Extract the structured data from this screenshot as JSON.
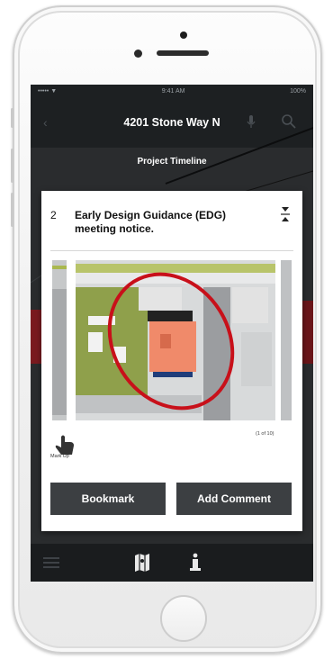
{
  "status_bar": {
    "carrier": "••••• ▼",
    "time": "9:41 AM",
    "battery": "100%"
  },
  "header": {
    "title": "4201 Stone Way N",
    "back_icon": "chevron-left-icon",
    "right_icons": [
      "mic-icon",
      "search-icon"
    ]
  },
  "subheader": {
    "title": "Project Timeline"
  },
  "card": {
    "item_number": "2",
    "item_title": "Early Design Guidance (EDG) meeting notice.",
    "collapse_icon": "collapse-icon",
    "markup_label": "Mark Up",
    "page_count": "(1 of 10)",
    "bookmark_label": "Bookmark",
    "add_comment_label": "Add Comment"
  },
  "tabbar": {
    "icons": [
      "list-icon",
      "map-icon",
      "info-icon"
    ]
  },
  "colors": {
    "screen_bg": "#1c1e20",
    "button_bg": "#3c3f42",
    "highlight_red": "#c8101a",
    "site_orange": "#f08a6a",
    "grass": "#8fa04b"
  }
}
